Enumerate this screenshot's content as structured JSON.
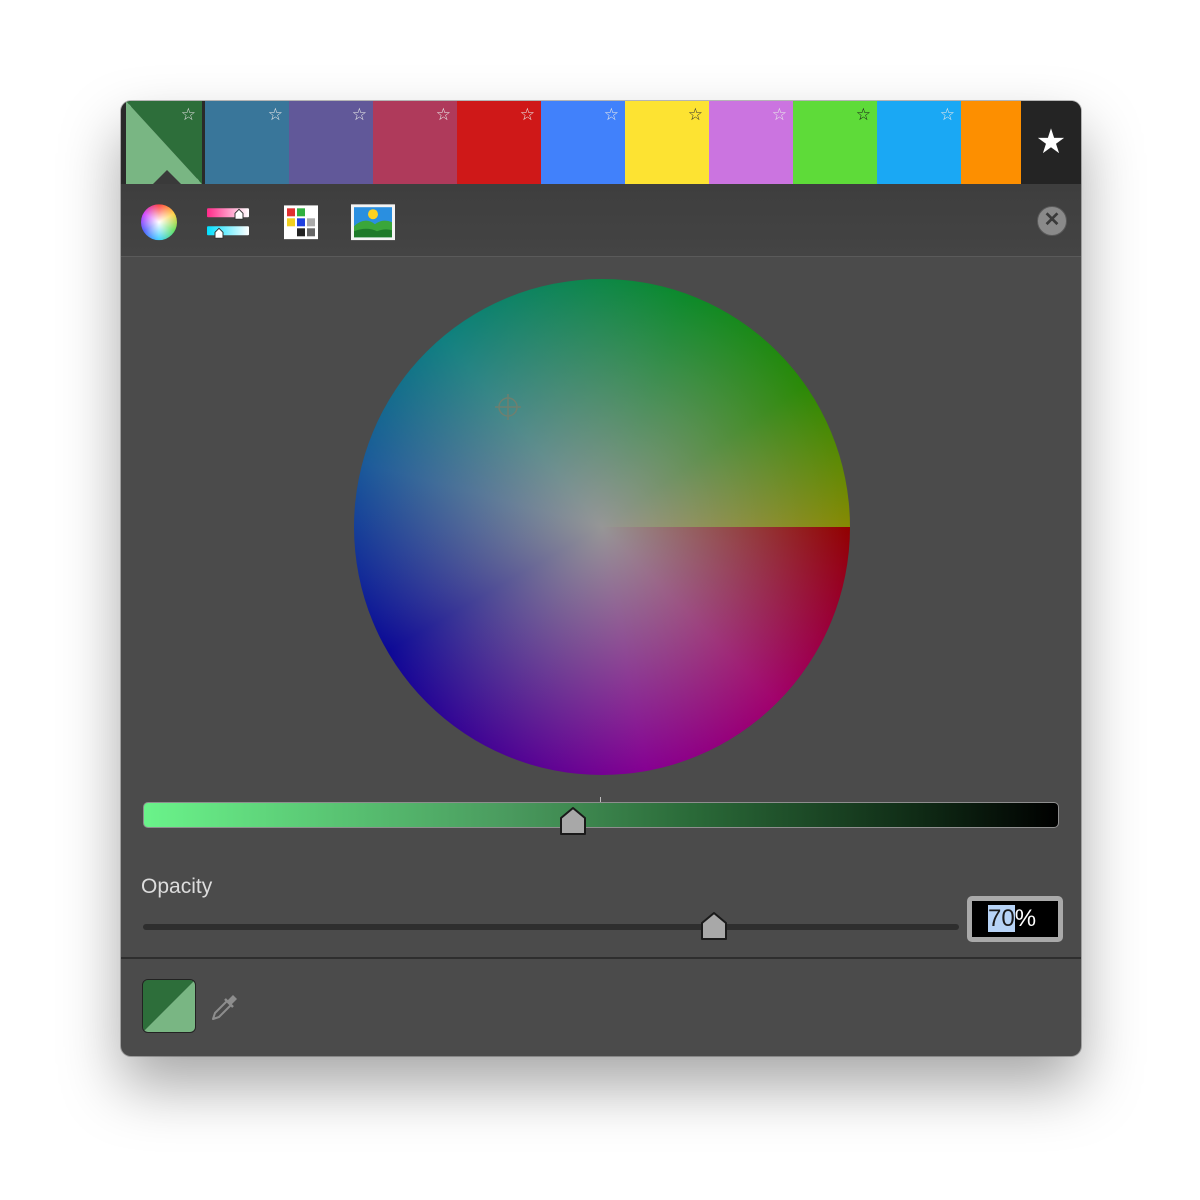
{
  "favorites": {
    "swatches": [
      {
        "name": "selected-green",
        "color": "#2d6e3a",
        "color2": "#79b683",
        "star": "☆",
        "star_color": "#dddddd"
      },
      {
        "name": "steel-blue",
        "color": "#39769a",
        "star": "☆",
        "star_color": "#e8e8e8"
      },
      {
        "name": "purple",
        "color": "#615899",
        "star": "☆",
        "star_color": "#e8e8e8"
      },
      {
        "name": "raspberry",
        "color": "#af3a5b",
        "star": "☆",
        "star_color": "#e8e8e8"
      },
      {
        "name": "red",
        "color": "#cf1818",
        "star": "☆",
        "star_color": "#e8e8e8"
      },
      {
        "name": "blue",
        "color": "#4181fb",
        "star": "☆",
        "star_color": "#e8e8e8"
      },
      {
        "name": "yellow",
        "color": "#fde332",
        "star": "☆",
        "star_color": "#333333"
      },
      {
        "name": "lilac",
        "color": "#cb74e0",
        "star": "☆",
        "star_color": "#e8e8e8"
      },
      {
        "name": "lime",
        "color": "#5edb39",
        "star": "☆",
        "star_color": "#1a1a1a"
      },
      {
        "name": "sky-blue",
        "color": "#1aa8f4",
        "star": "☆",
        "star_color": "#e8e8e8"
      },
      {
        "name": "orange",
        "color": "#fd8f00",
        "star": "",
        "star_color": "#e8e8e8"
      }
    ],
    "favorite_star": "★"
  },
  "toolbar": {
    "tabs": [
      {
        "name": "color-wheel",
        "icon": "color-wheel-icon",
        "active": true
      },
      {
        "name": "color-sliders",
        "icon": "sliders-icon",
        "active": false
      },
      {
        "name": "color-palettes",
        "icon": "palette-grid-icon",
        "active": false
      },
      {
        "name": "image-palettes",
        "icon": "image-icon",
        "active": false
      }
    ],
    "close_glyph": "✕"
  },
  "wheel": {
    "brightness": 0.47
  },
  "opacity": {
    "label": "Opacity",
    "value_selected": "70",
    "value_suffix": "%",
    "fraction": 0.7
  },
  "current_color": {
    "primary": "#2d6e3a",
    "secondary": "#79b683"
  }
}
